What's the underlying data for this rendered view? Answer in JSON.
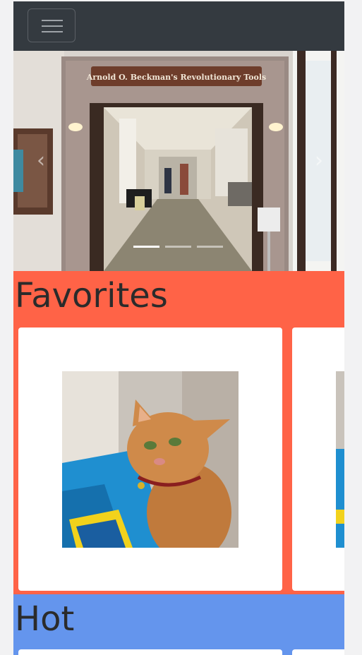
{
  "navbar": {
    "toggle_label": "Toggle navigation",
    "toggle_icon": "hamburger-icon"
  },
  "carousel": {
    "sign_text": "Arnold O. Beckman's Revolutionary Tools",
    "prev_glyph": "‹",
    "next_glyph": "›",
    "slides": 3,
    "active_slide": 1
  },
  "sections": {
    "favorites": {
      "title": "Favorites",
      "bg": "#ff6347"
    },
    "hot": {
      "title": "Hot",
      "bg": "#6495ed"
    }
  },
  "colors": {
    "navbar": "#343a40",
    "card": "#ffffff"
  }
}
